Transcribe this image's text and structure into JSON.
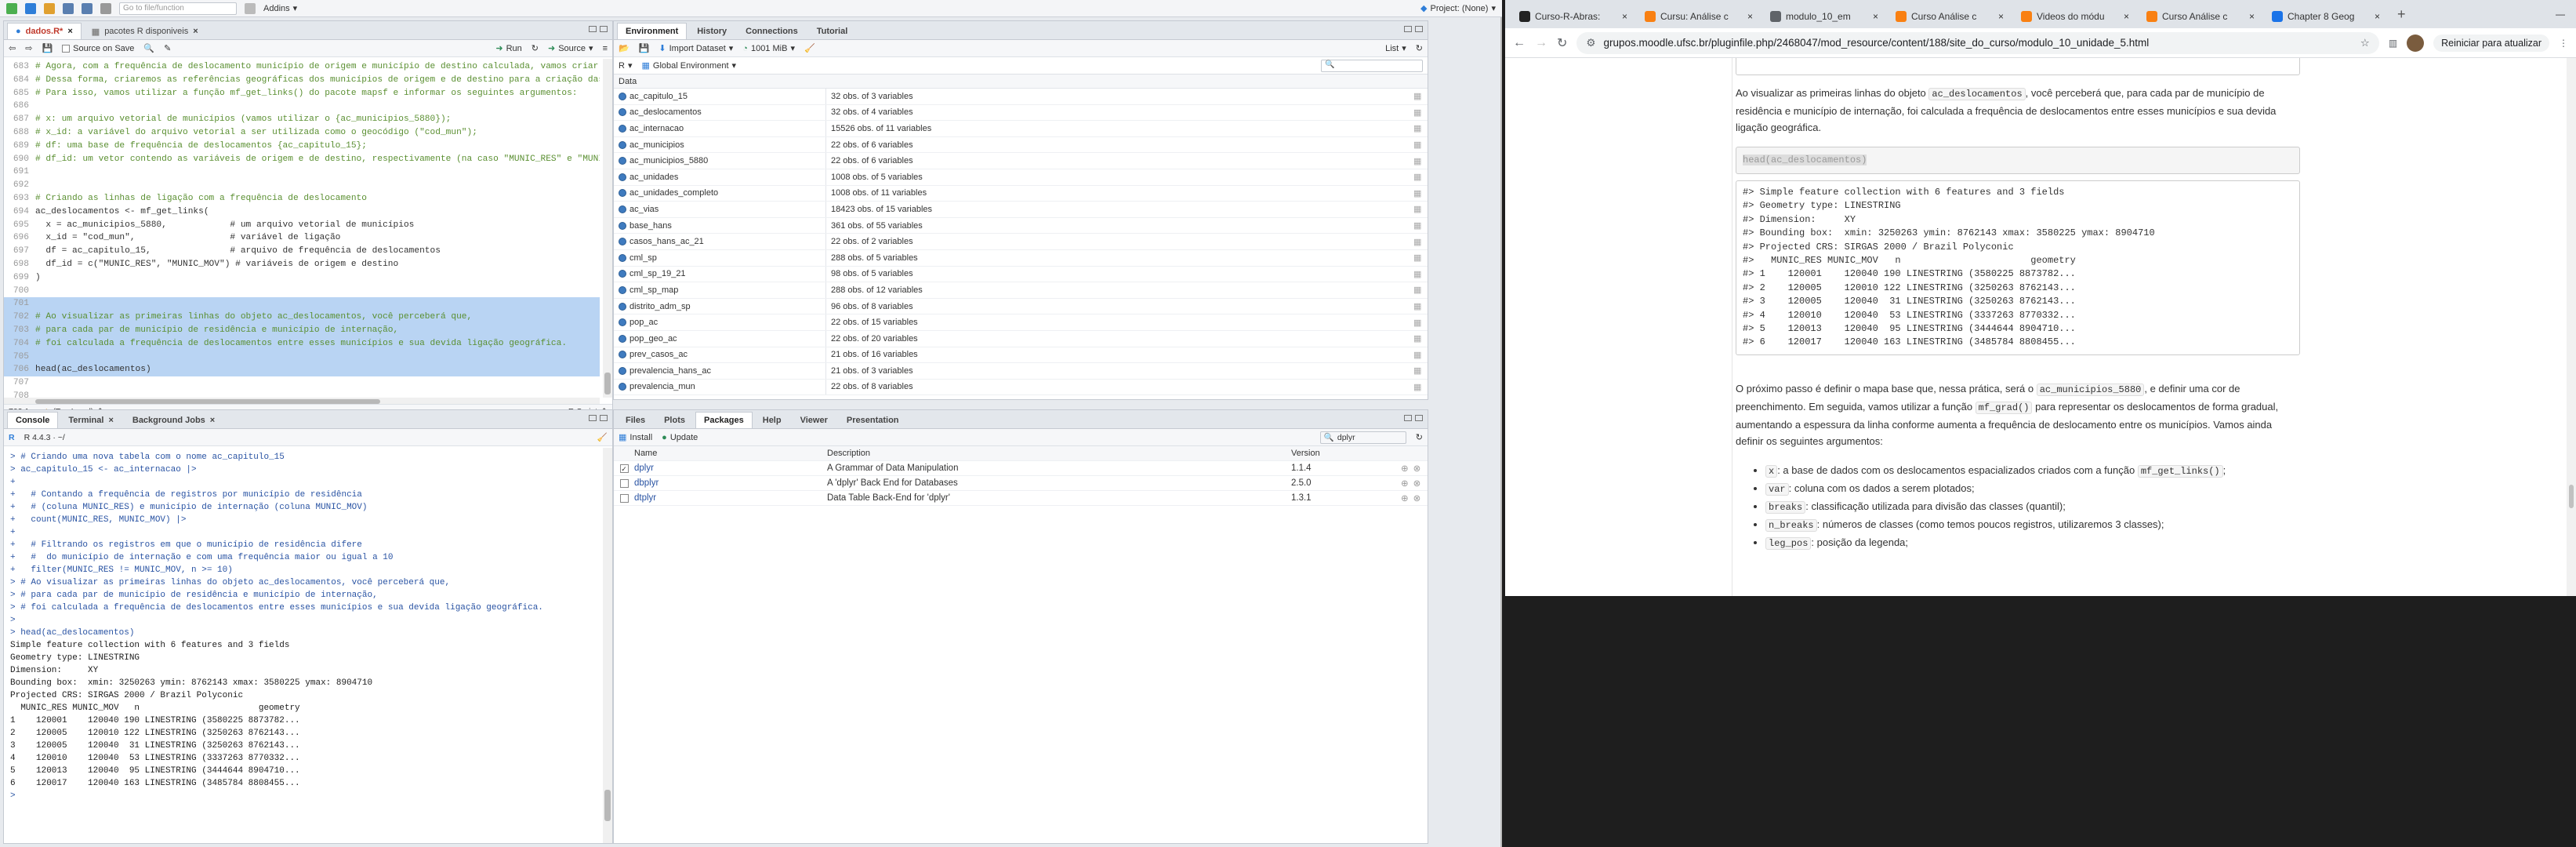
{
  "rstudio": {
    "toolbar": {
      "goto_placeholder": "Go to file/function",
      "addins": "Addins",
      "project": "Project: (None)"
    },
    "editor": {
      "tabs": [
        {
          "label": "dados.R*"
        },
        {
          "label": "pacotes R disponiveis"
        }
      ],
      "source_on_save": "Source on Save",
      "run": "Run",
      "source": "Source",
      "status_pos": "702:1",
      "status_scope": "(Top Level)",
      "status_type": "R Script",
      "lines": [
        {
          "n": "683",
          "t": "# Agora, com a frequência de deslocamento município de origem e município de destino calculada, vamos criar es",
          "cls": "cm"
        },
        {
          "n": "684",
          "t": "# Dessa forma, criaremos as referências geográficas dos municípios de origem e de destino para a criação das",
          "cls": "cm"
        },
        {
          "n": "685",
          "t": "# Para isso, vamos utilizar a função mf_get_links() do pacote mapsf e informar os seguintes argumentos:",
          "cls": "cm"
        },
        {
          "n": "686",
          "t": "",
          "cls": ""
        },
        {
          "n": "687",
          "t": "# x: um arquivo vetorial de municípios (vamos utilizar o {ac_municipios_5880});",
          "cls": "cm"
        },
        {
          "n": "688",
          "t": "# x_id: a variável do arquivo vetorial a ser utilizada como o geocódigo (\"cod_mun\");",
          "cls": "cm"
        },
        {
          "n": "689",
          "t": "# df: uma base de frequência de deslocamentos {ac_capitulo_15};",
          "cls": "cm"
        },
        {
          "n": "690",
          "t": "# df_id: um vetor contendo as variáveis de origem e de destino, respectivamente (na caso \"MUNIC_RES\" e \"MUNIC",
          "cls": "cm"
        },
        {
          "n": "691",
          "t": "",
          "cls": ""
        },
        {
          "n": "692",
          "t": "",
          "cls": ""
        },
        {
          "n": "693",
          "t": "# Criando as linhas de ligação com a frequência de deslocamento",
          "cls": "cm"
        },
        {
          "n": "694",
          "t": "ac_deslocamentos <- mf_get_links(",
          "cls": ""
        },
        {
          "n": "695",
          "t": "  x = ac_municipios_5880,            # um arquivo vetorial de municípios",
          "cls": ""
        },
        {
          "n": "696",
          "t": "  x_id = \"cod_mun\",                  # variável de ligação",
          "cls": ""
        },
        {
          "n": "697",
          "t": "  df = ac_capitulo_15,               # arquivo de frequência de deslocamentos",
          "cls": ""
        },
        {
          "n": "698",
          "t": "  df_id = c(\"MUNIC_RES\", \"MUNIC_MOV\") # variáveis de origem e destino",
          "cls": ""
        },
        {
          "n": "699",
          "t": ")",
          "cls": ""
        },
        {
          "n": "700",
          "t": "",
          "cls": ""
        },
        {
          "n": "701",
          "t": "",
          "cls": "sel"
        },
        {
          "n": "702",
          "t": "# Ao visualizar as primeiras linhas do objeto ac_deslocamentos, você perceberá que,",
          "cls": "cm sel"
        },
        {
          "n": "703",
          "t": "# para cada par de município de residência e município de internação,",
          "cls": "cm sel"
        },
        {
          "n": "704",
          "t": "# foi calculada a frequência de deslocamentos entre esses municípios e sua devida ligação geográfica.",
          "cls": "cm sel"
        },
        {
          "n": "705",
          "t": "",
          "cls": "sel"
        },
        {
          "n": "706",
          "t": "head(ac_deslocamentos)",
          "cls": "sel"
        },
        {
          "n": "707",
          "t": "",
          "cls": ""
        },
        {
          "n": "708",
          "t": "",
          "cls": ""
        }
      ]
    },
    "env": {
      "tabs": [
        {
          "label": "Environment"
        },
        {
          "label": "History"
        },
        {
          "label": "Connections"
        },
        {
          "label": "Tutorial"
        }
      ],
      "import_dataset": "Import Dataset",
      "memory": "1001 MiB",
      "list_label": "List",
      "lang": "R",
      "scope": "Global Environment",
      "section": "Data",
      "rows": [
        {
          "name": "ac_capitulo_15",
          "value": "32 obs. of 3 variables"
        },
        {
          "name": "ac_deslocamentos",
          "value": "32 obs. of 4 variables"
        },
        {
          "name": "ac_internacao",
          "value": "15526 obs. of 11 variables"
        },
        {
          "name": "ac_municipios",
          "value": "22 obs. of 6 variables"
        },
        {
          "name": "ac_municipios_5880",
          "value": "22 obs. of 6 variables"
        },
        {
          "name": "ac_unidades",
          "value": "1008 obs. of 5 variables"
        },
        {
          "name": "ac_unidades_completo",
          "value": "1008 obs. of 11 variables"
        },
        {
          "name": "ac_vias",
          "value": "18423 obs. of 15 variables"
        },
        {
          "name": "base_hans",
          "value": "361 obs. of 55 variables"
        },
        {
          "name": "casos_hans_ac_21",
          "value": "22 obs. of 2 variables"
        },
        {
          "name": "cml_sp",
          "value": "288 obs. of 5 variables"
        },
        {
          "name": "cml_sp_19_21",
          "value": "98 obs. of 5 variables"
        },
        {
          "name": "cml_sp_map",
          "value": "288 obs. of 12 variables"
        },
        {
          "name": "distrito_adm_sp",
          "value": "96 obs. of 8 variables"
        },
        {
          "name": "pop_ac",
          "value": "22 obs. of 15 variables"
        },
        {
          "name": "pop_geo_ac",
          "value": "22 obs. of 20 variables"
        },
        {
          "name": "prev_casos_ac",
          "value": "21 obs. of 16 variables"
        },
        {
          "name": "prevalencia_hans_ac",
          "value": "21 obs. of 3 variables"
        },
        {
          "name": "prevalencia_mun",
          "value": "22 obs. of 8 variables"
        }
      ]
    },
    "console": {
      "tabs": [
        {
          "label": "Console"
        },
        {
          "label": "Terminal"
        },
        {
          "label": "Background Jobs"
        }
      ],
      "version": "R 4.4.3 · ~/",
      "lines": [
        {
          "t": "> # Criando uma nova tabela com o nome ac_capitulo_15",
          "cls": "cblue"
        },
        {
          "t": "> ac_capitulo_15 <- ac_internacao |>",
          "cls": "cblue"
        },
        {
          "t": "+",
          "cls": "cblue"
        },
        {
          "t": "+   # Contando a frequência de registros por município de residência",
          "cls": "cblue"
        },
        {
          "t": "+   # (coluna MUNIC_RES) e município de internação (coluna MUNIC_MOV)",
          "cls": "cblue"
        },
        {
          "t": "+   count(MUNIC_RES, MUNIC_MOV) |>",
          "cls": "cblue"
        },
        {
          "t": "+",
          "cls": "cblue"
        },
        {
          "t": "+   # Filtrando os registros em que o município de residência difere",
          "cls": "cblue"
        },
        {
          "t": "+   #  do município de internação e com uma frequência maior ou igual a 10",
          "cls": "cblue"
        },
        {
          "t": "+   filter(MUNIC_RES != MUNIC_MOV, n >= 10)",
          "cls": "cblue"
        },
        {
          "t": "> # Ao visualizar as primeiras linhas do objeto ac_deslocamentos, você perceberá que,",
          "cls": "cblue"
        },
        {
          "t": "> # para cada par de município de residência e município de internação,",
          "cls": "cblue"
        },
        {
          "t": "> # foi calculada a frequência de deslocamentos entre esses municípios e sua devida ligação geográfica.",
          "cls": "cblue"
        },
        {
          "t": ">",
          "cls": "cblue"
        },
        {
          "t": "> head(ac_deslocamentos)",
          "cls": "cblue"
        },
        {
          "t": "Simple feature collection with 6 features and 3 fields",
          "cls": ""
        },
        {
          "t": "Geometry type: LINESTRING",
          "cls": ""
        },
        {
          "t": "Dimension:     XY",
          "cls": ""
        },
        {
          "t": "Bounding box:  xmin: 3250263 ymin: 8762143 xmax: 3580225 ymax: 8904710",
          "cls": ""
        },
        {
          "t": "Projected CRS: SIRGAS 2000 / Brazil Polyconic",
          "cls": ""
        },
        {
          "t": "  MUNIC_RES MUNIC_MOV   n                       geometry",
          "cls": ""
        },
        {
          "t": "1    120001    120040 190 LINESTRING (3580225 8873782...",
          "cls": ""
        },
        {
          "t": "2    120005    120010 122 LINESTRING (3250263 8762143...",
          "cls": ""
        },
        {
          "t": "3    120005    120040  31 LINESTRING (3250263 8762143...",
          "cls": ""
        },
        {
          "t": "4    120010    120040  53 LINESTRING (3337263 8770332...",
          "cls": ""
        },
        {
          "t": "5    120013    120040  95 LINESTRING (3444644 8904710...",
          "cls": ""
        },
        {
          "t": "6    120017    120040 163 LINESTRING (3485784 8808455...",
          "cls": ""
        },
        {
          "t": ">",
          "cls": "cblue"
        }
      ]
    },
    "files": {
      "tabs": [
        {
          "label": "Files"
        },
        {
          "label": "Plots"
        },
        {
          "label": "Packages"
        },
        {
          "label": "Help"
        },
        {
          "label": "Viewer"
        },
        {
          "label": "Presentation"
        }
      ],
      "install": "Install",
      "update": "Update",
      "search_value": "dplyr",
      "col_name": "Name",
      "col_desc": "Description",
      "col_ver": "Version",
      "packages": [
        {
          "name": "dplyr",
          "desc": "A Grammar of Data Manipulation",
          "ver": "1.1.4",
          "checked": true
        },
        {
          "name": "dbplyr",
          "desc": "A 'dplyr' Back End for Databases",
          "ver": "2.5.0",
          "checked": false
        },
        {
          "name": "dtplyr",
          "desc": "Data Table Back-End for 'dplyr'",
          "ver": "1.3.1",
          "checked": false
        }
      ]
    }
  },
  "chrome": {
    "tabs": [
      {
        "label": "Curso-R-Abras:",
        "color": "#222222"
      },
      {
        "label": "Cursu: Análise c",
        "color": "#f98012"
      },
      {
        "label": "modulo_10_em",
        "color": "#5f6368"
      },
      {
        "label": "Curso Análise c",
        "color": "#f98012"
      },
      {
        "label": "Videos do módu",
        "color": "#f98012"
      },
      {
        "label": "Curso Análise c",
        "color": "#f98012"
      },
      {
        "label": "Chapter 8 Geog",
        "color": "#1a73e8"
      }
    ],
    "url": "grupos.moodle.ufsc.br/pluginfile.php/2468047/mod_resource/content/188/site_do_curso/modulo_10_unidade_5.html",
    "update_btn": "Reiniciar para atualizar",
    "doc": {
      "p1_a": "Ao visualizar as primeiras linhas do objeto",
      "p1_code": "ac_deslocamentos",
      "p1_b": ", você perceberá que, para cada par de município de residência e município de internação, foi calculada a frequência de deslocamentos entre esses municípios e sua devida ligação geográfica.",
      "code1": "head(ac_deslocamentos)",
      "out_lines": [
        "#> Simple feature collection with 6 features and 3 fields",
        "#> Geometry type: LINESTRING",
        "#> Dimension:     XY",
        "#> Bounding box:  xmin: 3250263 ymin: 8762143 xmax: 3580225 ymax: 8904710",
        "#> Projected CRS: SIRGAS 2000 / Brazil Polyconic",
        "#>   MUNIC_RES MUNIC_MOV   n                       geometry",
        "#> 1    120001    120040 190 LINESTRING (3580225 8873782...",
        "#> 2    120005    120010 122 LINESTRING (3250263 8762143...",
        "#> 3    120005    120040  31 LINESTRING (3250263 8762143...",
        "#> 4    120010    120040  53 LINESTRING (3337263 8770332...",
        "#> 5    120013    120040  95 LINESTRING (3444644 8904710...",
        "#> 6    120017    120040 163 LINESTRING (3485784 8808455..."
      ],
      "p2_a": "O próximo passo é definir o mapa base que, nessa prática, será o",
      "p2_code1": "ac_municipios_5880",
      "p2_b": ", e definir uma cor de preenchimento. Em seguida, vamos utilizar a função",
      "p2_code2": "mf_grad()",
      "p2_c": "para representar os deslocamentos de forma gradual, aumentando a espessura da linha conforme aumenta a frequência de deslocamento entre os municípios. Vamos ainda definir os seguintes argumentos:",
      "bullets": [
        {
          "code": "x",
          "text": ": a base de dados com os deslocamentos espacializados criados com a função",
          "code2": "mf_get_links()",
          "tail": ";"
        },
        {
          "code": "var",
          "text": ": coluna com os dados a serem plotados;",
          "code2": "",
          "tail": ""
        },
        {
          "code": "breaks",
          "text": ": classificação utilizada para divisão das classes (quantil);",
          "code2": "",
          "tail": ""
        },
        {
          "code": "n_breaks",
          "text": ": números de classes (como temos poucos registros, utilizaremos 3 classes);",
          "code2": "",
          "tail": ""
        },
        {
          "code": "leg_pos",
          "text": ": posição da legenda;",
          "code2": "",
          "tail": ""
        }
      ]
    }
  }
}
